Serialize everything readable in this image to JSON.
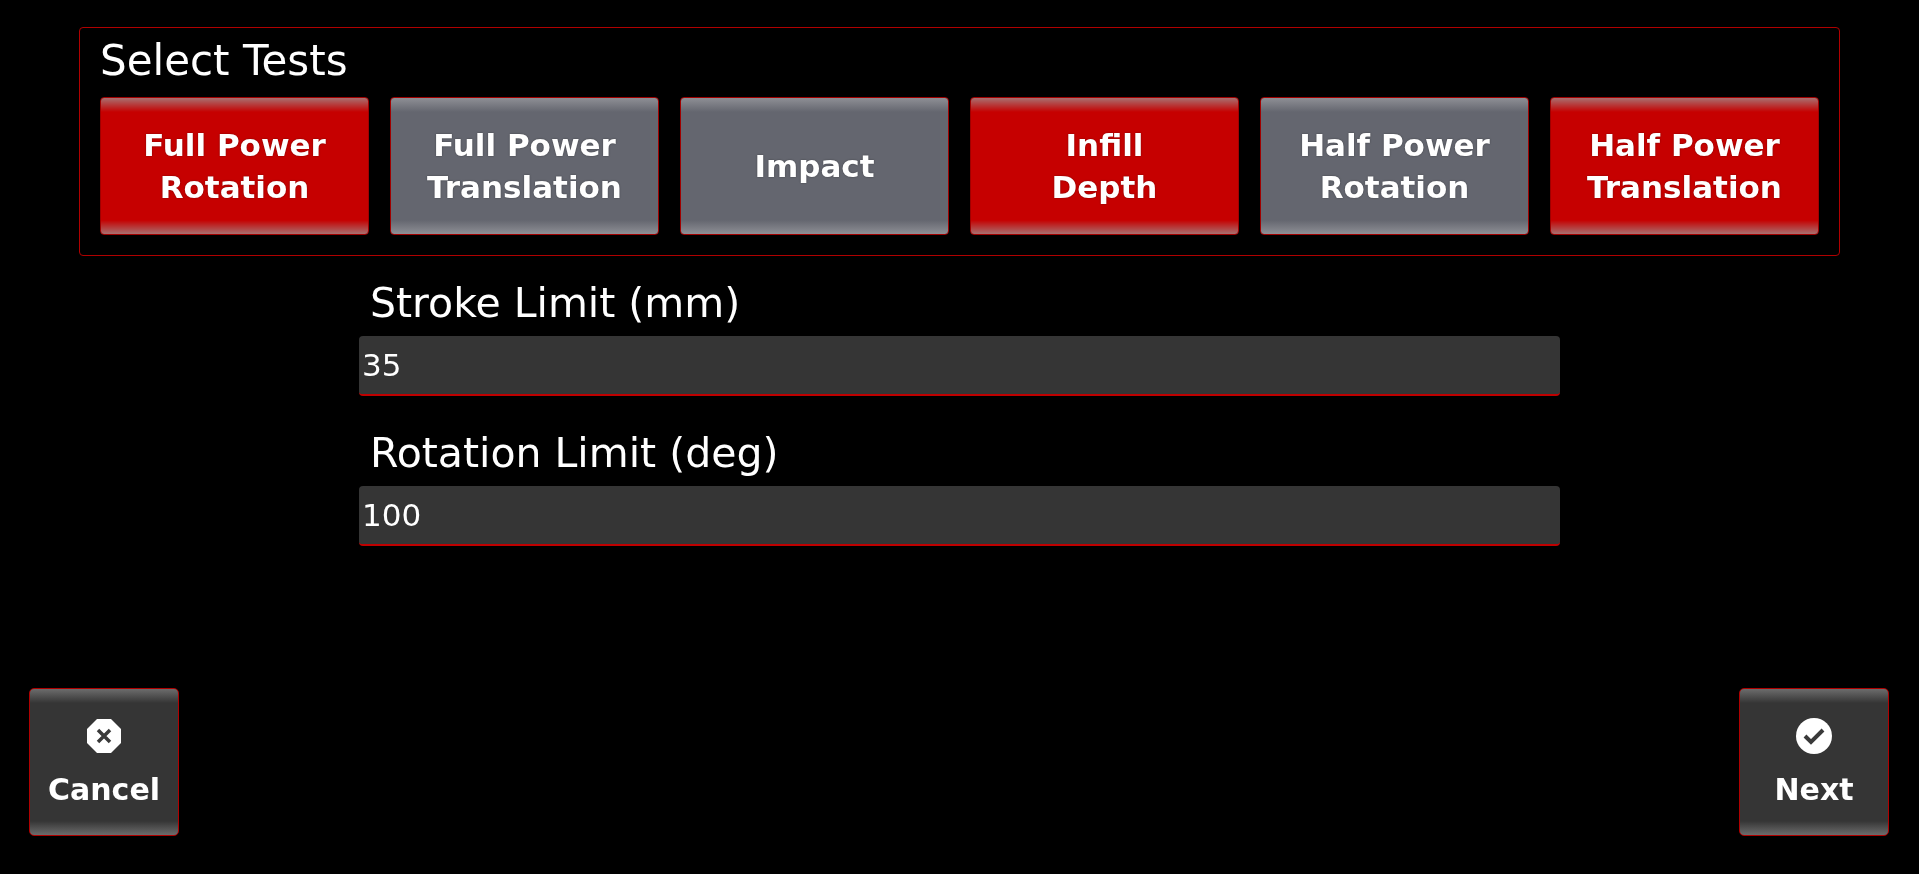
{
  "panel": {
    "title": "Select Tests",
    "tests": [
      {
        "label": "Full Power\nRotation",
        "selected": true
      },
      {
        "label": "Full Power\nTranslation",
        "selected": false
      },
      {
        "label": "Impact",
        "selected": false
      },
      {
        "label": "Infill\nDepth",
        "selected": true
      },
      {
        "label": "Half Power\nRotation",
        "selected": false
      },
      {
        "label": "Half Power\nTranslation",
        "selected": true
      }
    ]
  },
  "fields": [
    {
      "label": "Stroke Limit (mm)",
      "value": "35"
    },
    {
      "label": "Rotation Limit (deg)",
      "value": "100"
    }
  ],
  "actions": [
    {
      "kind": "cancel",
      "label": "Cancel"
    },
    {
      "kind": "next",
      "label": "Next"
    }
  ]
}
